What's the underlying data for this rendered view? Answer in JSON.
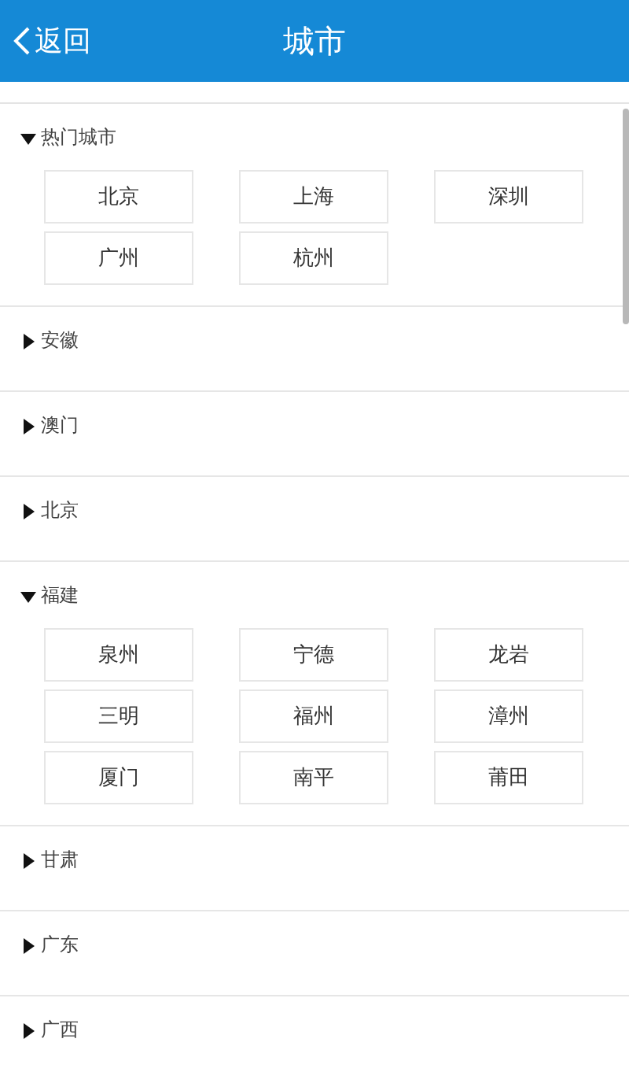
{
  "header": {
    "back": "返回",
    "title": "城市"
  },
  "sections": [
    {
      "name": "热门城市",
      "expanded": true,
      "cities": [
        "北京",
        "上海",
        "深圳",
        "广州",
        "杭州"
      ]
    },
    {
      "name": "安徽",
      "expanded": false
    },
    {
      "name": "澳门",
      "expanded": false
    },
    {
      "name": "北京",
      "expanded": false
    },
    {
      "name": "福建",
      "expanded": true,
      "cities": [
        "泉州",
        "宁德",
        "龙岩",
        "三明",
        "福州",
        "漳州",
        "厦门",
        "南平",
        "莆田"
      ]
    },
    {
      "name": "甘肃",
      "expanded": false
    },
    {
      "name": "广东",
      "expanded": false
    },
    {
      "name": "广西",
      "expanded": false
    }
  ]
}
